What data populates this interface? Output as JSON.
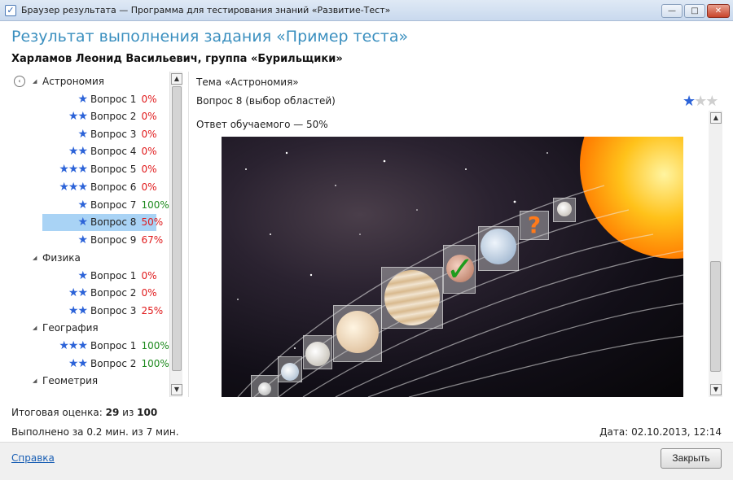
{
  "window": {
    "title": "Браузер результата — Программа для тестирования знаний «Развитие-Тест»",
    "min_glyph": "—",
    "max_glyph": "□",
    "close_glyph": "✕"
  },
  "header": {
    "title": "Результат выполнения задания «Пример теста»",
    "student": "Харламов Леонид Васильевич, группа «Бурильщики»"
  },
  "tree": {
    "back_glyph": "‹",
    "expand_glyph": "◢",
    "categories": [
      {
        "name": "Астрономия",
        "questions": [
          {
            "stars": "★",
            "label": "Вопрос 1",
            "pct": "0%"
          },
          {
            "stars": "★★",
            "label": "Вопрос 2",
            "pct": "0%"
          },
          {
            "stars": "★",
            "label": "Вопрос 3",
            "pct": "0%"
          },
          {
            "stars": "★★",
            "label": "Вопрос 4",
            "pct": "0%"
          },
          {
            "stars": "★★★",
            "label": "Вопрос 5",
            "pct": "0%"
          },
          {
            "stars": "★★★",
            "label": "Вопрос 6",
            "pct": "0%"
          },
          {
            "stars": "★",
            "label": "Вопрос 7",
            "pct": "100%"
          },
          {
            "stars": "★",
            "label": "Вопрос 8",
            "pct": "50%"
          },
          {
            "stars": "★",
            "label": "Вопрос 9",
            "pct": "67%"
          }
        ]
      },
      {
        "name": "Физика",
        "questions": [
          {
            "stars": "★",
            "label": "Вопрос 1",
            "pct": "0%"
          },
          {
            "stars": "★★",
            "label": "Вопрос 2",
            "pct": "0%"
          },
          {
            "stars": "★★",
            "label": "Вопрос 3",
            "pct": "25%"
          }
        ]
      },
      {
        "name": "География",
        "questions": [
          {
            "stars": "★★★",
            "label": "Вопрос 1",
            "pct": "100%"
          },
          {
            "stars": "★★",
            "label": "Вопрос 2",
            "pct": "100%"
          }
        ]
      },
      {
        "name": "Геометрия",
        "questions": []
      }
    ]
  },
  "detail": {
    "topic": "Тема «Астрономия»",
    "question": "Вопрос 8 (выбор областей)",
    "rating_on": "★",
    "rating_off": "★★",
    "answer": "Ответ обучаемого — 50%",
    "check_glyph": "✓",
    "question_glyph": "?"
  },
  "scroll": {
    "up_glyph": "▲",
    "down_glyph": "▼"
  },
  "summary": {
    "total_label": "Итоговая оценка:",
    "total_score": "29",
    "total_of": "из",
    "total_max": "100",
    "duration": "Выполнено за 0.2 мин. из 7 мин.",
    "date": "Дата: 02.10.2013, 12:14"
  },
  "footer": {
    "help": "Справка",
    "close": "Закрыть"
  },
  "colors": {
    "title_blue": "#3a8fbf",
    "star_blue": "#2c63d8",
    "fail_red": "#e0191b",
    "pass_green": "#1e8a1e",
    "selected_row": "#a9d3f5"
  }
}
